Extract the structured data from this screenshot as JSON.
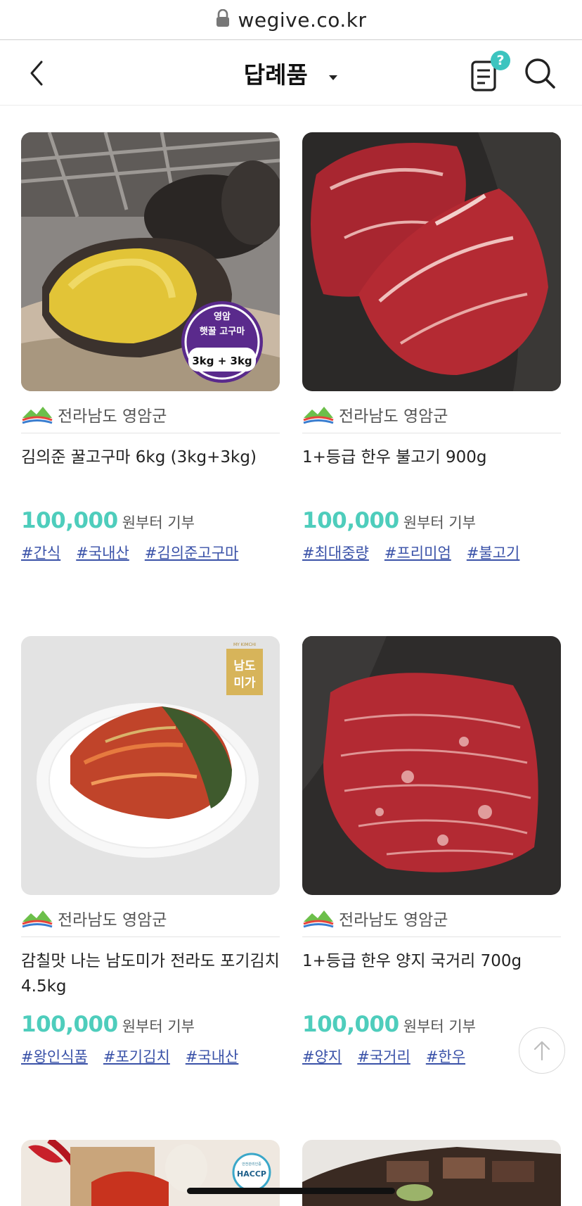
{
  "browser": {
    "url": "wegive.co.kr"
  },
  "header": {
    "title": "답례품",
    "help_badge": "?"
  },
  "products": [
    {
      "region": "전라남도 영암군",
      "title": "김의준 꿀고구마 6kg (3kg+3kg)",
      "price": "100,000",
      "price_suffix": "원부터 기부",
      "tags": [
        "#간식",
        "#국내산",
        "#김의준고구마"
      ],
      "badge": {
        "line1": "영암",
        "line2": "햇꿀 고구마",
        "line3": "3kg + 3kg"
      }
    },
    {
      "region": "전라남도 영암군",
      "title": "1+등급 한우 불고기 900g",
      "price": "100,000",
      "price_suffix": "원부터 기부",
      "tags": [
        "#최대중량",
        "#프리미엄",
        "#불고기"
      ]
    },
    {
      "region": "전라남도 영암군",
      "title": "감칠맛 나는 남도미가 전라도 포기김치 4.5kg",
      "price": "100,000",
      "price_suffix": "원부터 기부",
      "tags": [
        "#왕인식품",
        "#포기김치",
        "#국내산"
      ],
      "brand": {
        "top": "MY KIMCHI",
        "line1": "남도",
        "line2": "미가"
      }
    },
    {
      "region": "전라남도 영암군",
      "title": "1+등급 한우 양지 국거리 700g",
      "price": "100,000",
      "price_suffix": "원부터 기부",
      "tags": [
        "#양지",
        "#국거리",
        "#한우"
      ]
    }
  ],
  "partial_badge": {
    "top": "안전관리인증",
    "main": "HACCP"
  },
  "colors": {
    "accent": "#4ecdbc",
    "tag_link": "#3a52a8",
    "badge_purple": "#5a2a8c",
    "help_badge": "#3cc4bf"
  },
  "icons": {
    "back": "chevron-left-icon",
    "dropdown": "caret-down-icon",
    "notes": "notes-icon",
    "search": "search-icon",
    "scroll_top": "arrow-up-icon",
    "region": "mountain-logo-icon"
  }
}
